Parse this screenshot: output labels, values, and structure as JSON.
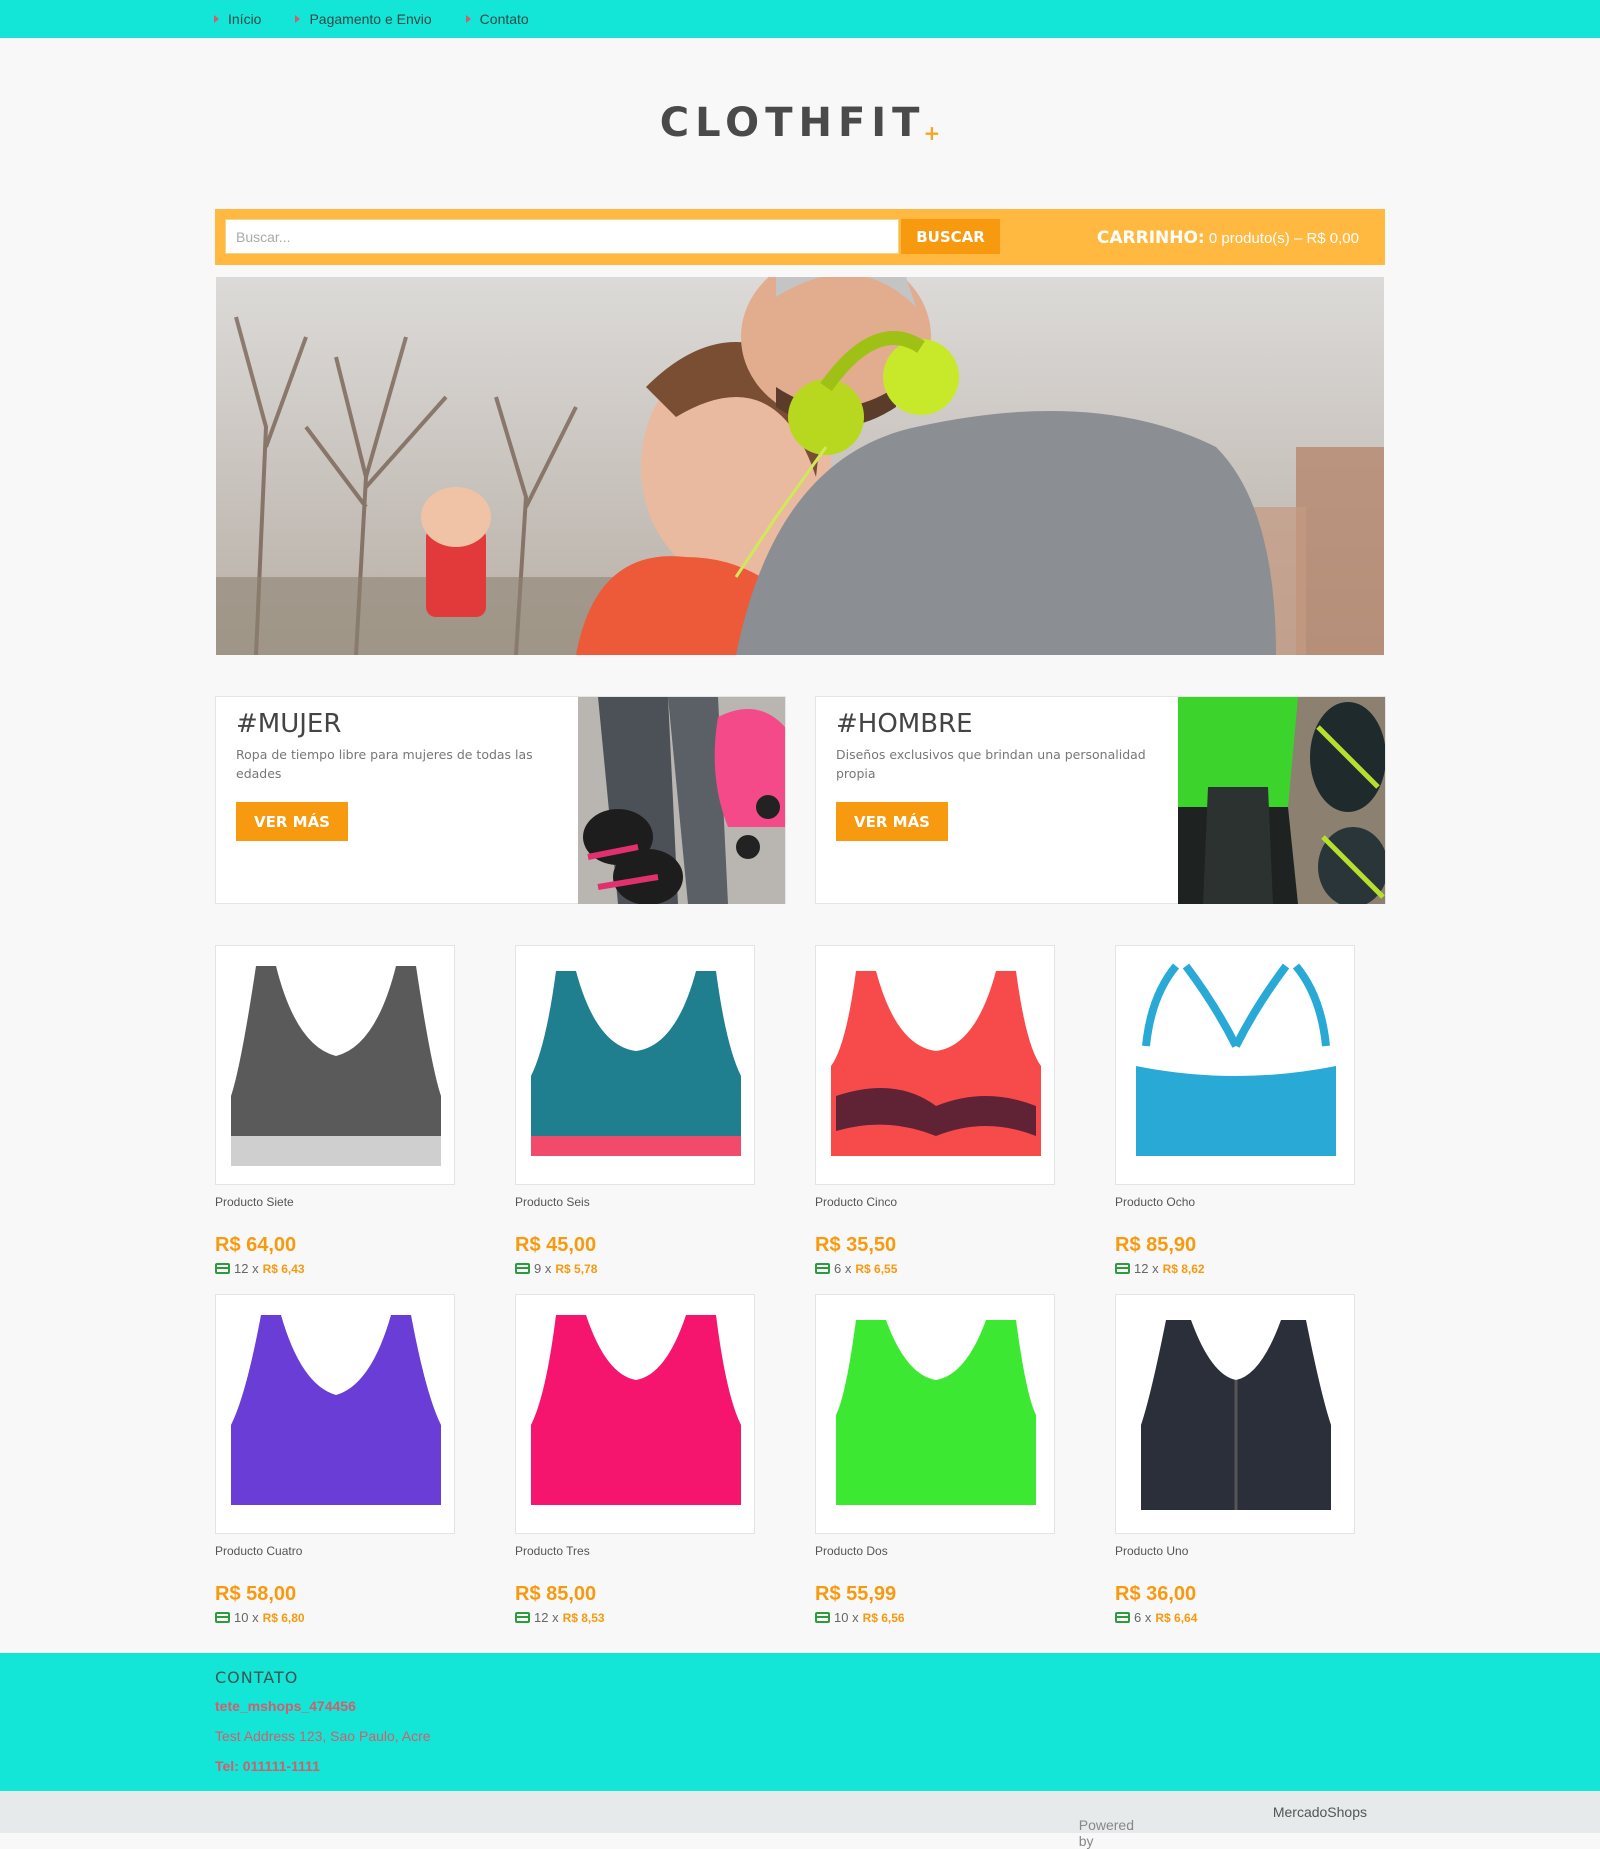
{
  "topnav": {
    "items": [
      {
        "label": "Início"
      },
      {
        "label": "Pagamento e Envio"
      },
      {
        "label": "Contato"
      }
    ]
  },
  "logo": {
    "text": "CLOTHFIT",
    "plus": "+"
  },
  "search": {
    "placeholder": "Buscar...",
    "button_label": "BUSCAR"
  },
  "cart": {
    "title": "CARRINHO:",
    "summary": "0 produto(s) – R$ 0,00"
  },
  "promos": [
    {
      "title": "#MUJER",
      "description": "Ropa de tiempo libre para mujeres de todas las edades",
      "button_label": "VER MÁS"
    },
    {
      "title": "#HOMBRE",
      "description": "Diseños exclusivos que brindan una personalidad propia",
      "button_label": "VER MÁS"
    }
  ],
  "products": [
    {
      "name": "Producto Siete",
      "price": "R$ 64,00",
      "installments": "12 x",
      "installment_value": "R$ 6,43",
      "color": "#5a5a5a"
    },
    {
      "name": "Producto Seis",
      "price": "R$ 45,00",
      "installments": "9 x",
      "installment_value": "R$ 5,78",
      "color": "#1f7f8e"
    },
    {
      "name": "Producto Cinco",
      "price": "R$ 35,50",
      "installments": "6 x",
      "installment_value": "R$ 6,55",
      "color": "#f74a4a"
    },
    {
      "name": "Producto Ocho",
      "price": "R$ 85,90",
      "installments": "12 x",
      "installment_value": "R$ 8,62",
      "color": "#28a9d6"
    },
    {
      "name": "Producto Cuatro",
      "price": "R$ 58,00",
      "installments": "10 x",
      "installment_value": "R$ 6,80",
      "color": "#6a3dd6"
    },
    {
      "name": "Producto Tres",
      "price": "R$ 85,00",
      "installments": "12 x",
      "installment_value": "R$ 8,53",
      "color": "#f5156e"
    },
    {
      "name": "Producto Dos",
      "price": "R$ 55,99",
      "installments": "10 x",
      "installment_value": "R$ 6,56",
      "color": "#3de832"
    },
    {
      "name": "Producto Uno",
      "price": "R$ 36,00",
      "installments": "6 x",
      "installment_value": "R$ 6,64",
      "color": "#2a2f3a"
    }
  ],
  "footer": {
    "title": "CONTATO",
    "user": "tete_mshops_474456",
    "address": "Test Address 123, Sao Paulo, Acre",
    "tel": "Tel: 011111-1111"
  },
  "powered": {
    "prefix": "Powered by",
    "brand": "MercadoShops",
    "suffix": "."
  },
  "colors": {
    "accent": "#13e6d6",
    "orange": "#f79a10",
    "searchbar": "#ffb941"
  }
}
